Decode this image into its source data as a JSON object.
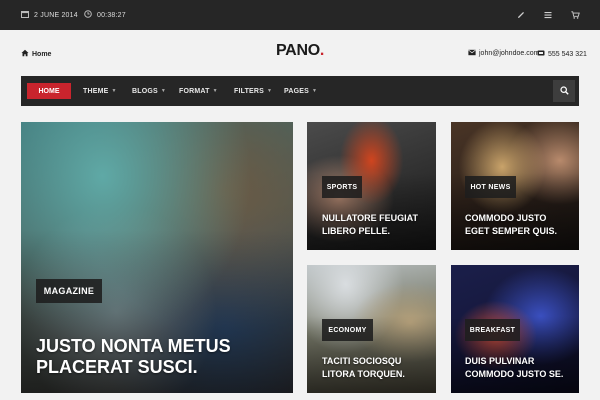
{
  "topbar": {
    "date": "2 JUNE 2014",
    "time": "00:38:27",
    "icons": [
      "edit-icon",
      "menu-icon",
      "cart-icon"
    ]
  },
  "header": {
    "home_label": "Home",
    "logo_text": "PANO",
    "logo_dot": ".",
    "email": "john@johndoe.com",
    "phone": "555 543 321"
  },
  "nav": {
    "items": [
      {
        "label": "HOME",
        "active": true
      },
      {
        "label": "THEME",
        "dropdown": true
      },
      {
        "label": "BLOGS",
        "dropdown": true
      },
      {
        "label": "FORMAT",
        "dropdown": true
      },
      {
        "label": "FILTERS",
        "dropdown": true
      },
      {
        "label": "PAGES",
        "dropdown": true
      }
    ],
    "search_icon": "search-icon"
  },
  "cards": {
    "featured": {
      "tag": "MAGAZINE",
      "title_line1": "JUSTO NONTA METUS",
      "title_line2": "PLACERAT SUSCI."
    },
    "sports": {
      "tag": "SPORTS",
      "title_line1": "NULLATORE FEUGIAT",
      "title_line2": "LIBERO PELLE."
    },
    "hotnews": {
      "tag": "HOT NEWS",
      "title_line1": "COMMODO JUSTO",
      "title_line2": "EGET SEMPER QUIS."
    },
    "economy": {
      "tag": "ECONOMY",
      "title_line1": "TACITI SOCIOSQU",
      "title_line2": "LITORA TORQUEN."
    },
    "breakfast": {
      "tag": "BREAKFAST",
      "title_line1": "DUIS PULVINAR",
      "title_line2": "COMMODO JUSTO SE."
    }
  },
  "colors": {
    "accent": "#c9242d",
    "dark": "#262626",
    "background": "#f2f2f2"
  }
}
